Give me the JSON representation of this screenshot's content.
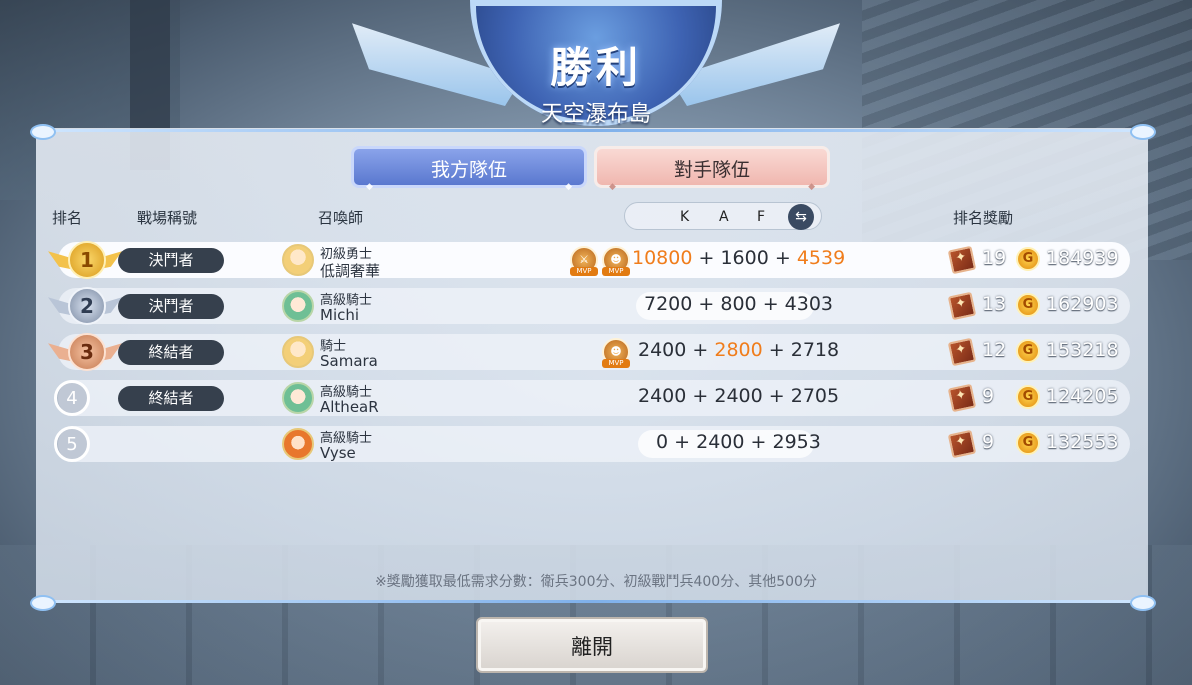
{
  "header": {
    "title": "勝利",
    "subtitle": "天空瀑布島"
  },
  "tabs": {
    "ours": "我方隊伍",
    "theirs": "對手隊伍"
  },
  "columns": {
    "rank": "排名",
    "battle_title": "戰場稱號",
    "summoner": "召喚師",
    "kaf": [
      "K",
      "A",
      "F"
    ],
    "reward": "排名獎勵"
  },
  "rows": [
    {
      "rank": "1",
      "badge": "決鬥者",
      "rank_title": "初級勇士",
      "name": "低調奢華",
      "k": "10800",
      "a": "1600",
      "f": "4539",
      "mvp_count": 2,
      "books": "19",
      "coins": "184939"
    },
    {
      "rank": "2",
      "badge": "決鬥者",
      "rank_title": "高級騎士",
      "name": "Michi",
      "k": "7200",
      "a": "800",
      "f": "4303",
      "mvp_count": 0,
      "books": "13",
      "coins": "162903"
    },
    {
      "rank": "3",
      "badge": "終結者",
      "rank_title": "騎士",
      "name": "Samara",
      "k": "2400",
      "a": "2800",
      "f": "2718",
      "mvp_count": 1,
      "books": "12",
      "coins": "153218"
    },
    {
      "rank": "4",
      "badge": "終結者",
      "rank_title": "高級騎士",
      "name": "AltheaR",
      "k": "2400",
      "a": "2400",
      "f": "2705",
      "mvp_count": 0,
      "books": "9",
      "coins": "124205"
    },
    {
      "rank": "5",
      "badge": "",
      "rank_title": "高級騎士",
      "name": "Vyse",
      "k": "0",
      "a": "2400",
      "f": "2953",
      "mvp_count": 0,
      "books": "9",
      "coins": "132553"
    }
  ],
  "mvp_tag": "MVP",
  "sep": "+",
  "coin_glyph": "G",
  "note": "※獎勵獲取最低需求分數：衛兵300分、初級戰鬥兵400分、其他500分",
  "leave_label": "離開",
  "colors": {
    "highlight": "#f07d1c",
    "badge_bg": "#36404d",
    "accent": "#5a78cf"
  },
  "icons": {
    "swap": "swap-arrows-icon",
    "book": "reward-book-icon",
    "coin": "gold-coin-icon"
  }
}
